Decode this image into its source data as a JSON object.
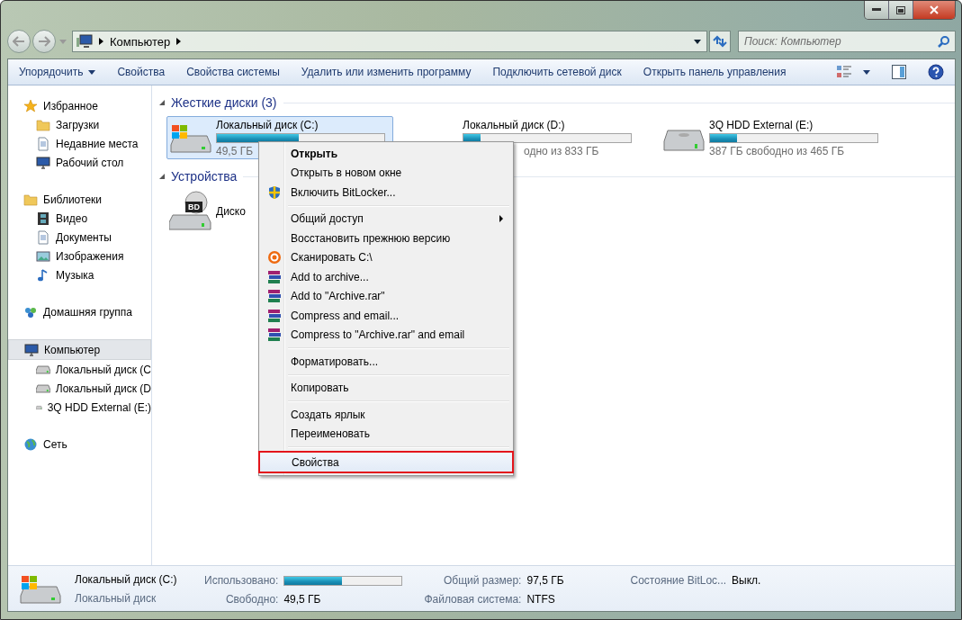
{
  "address_bar": {
    "path": [
      {
        "label": "Компьютер"
      }
    ]
  },
  "search": {
    "placeholder": "Поиск: Компьютер"
  },
  "toolbar": {
    "items": [
      {
        "label": "Упорядочить",
        "dropdown": true
      },
      {
        "label": "Свойства",
        "dropdown": false
      },
      {
        "label": "Свойства системы",
        "dropdown": false
      },
      {
        "label": "Удалить или изменить программу",
        "dropdown": false
      },
      {
        "label": "Подключить сетевой диск",
        "dropdown": false
      },
      {
        "label": "Открыть панель управления",
        "dropdown": false
      }
    ]
  },
  "sidebar": {
    "groups": [
      {
        "label": "Избранное",
        "selected": false,
        "children": [
          {
            "label": "Загрузки",
            "selected": false
          },
          {
            "label": "Недавние места",
            "selected": false
          },
          {
            "label": "Рабочий стол",
            "selected": false
          }
        ]
      },
      {
        "label": "Библиотеки",
        "selected": false,
        "children": [
          {
            "label": "Видео",
            "selected": false
          },
          {
            "label": "Документы",
            "selected": false
          },
          {
            "label": "Изображения",
            "selected": false
          },
          {
            "label": "Музыка",
            "selected": false
          }
        ]
      },
      {
        "label": "Домашняя группа",
        "selected": false
      },
      {
        "label": "Компьютер",
        "selected": true,
        "children": [
          {
            "label": "Локальный диск (C",
            "selected": false
          },
          {
            "label": "Локальный диск (D",
            "selected": false
          },
          {
            "label": "3Q HDD External (E:)",
            "selected": false
          }
        ]
      },
      {
        "label": "Сеть",
        "selected": false
      }
    ]
  },
  "content": {
    "sections": [
      {
        "title": "Жесткие диски (3)",
        "items": [
          {
            "name": "Локальный диск (C:)",
            "level": 0.49,
            "free": "49,5 ГБ",
            "selected": true
          },
          {
            "name": "Локальный диск (D:)",
            "level": 0.1,
            "free": "одно из 833 ГБ",
            "selected": false
          },
          {
            "name": "3Q HDD External (E:)",
            "level": 0.16,
            "free": "387 ГБ свободно из 465 ГБ",
            "selected": false
          }
        ]
      },
      {
        "title": "Устройства",
        "items": [
          {
            "name": "Диско",
            "badge": "BD",
            "selected": false
          }
        ]
      }
    ]
  },
  "context_menu": {
    "groups": [
      [
        {
          "label": "Открыть",
          "kind": "plain",
          "default": true,
          "submenu": false,
          "selected": false,
          "annotated": false
        },
        {
          "label": "Открыть в новом окне",
          "kind": "plain",
          "default": false,
          "submenu": false,
          "selected": false,
          "annotated": false
        },
        {
          "label": "Включить BitLocker...",
          "kind": "shield",
          "default": false,
          "submenu": false,
          "selected": false,
          "annotated": false
        }
      ],
      [
        {
          "label": "Общий доступ",
          "kind": "plain",
          "default": false,
          "submenu": true,
          "selected": false,
          "annotated": false
        },
        {
          "label": "Восстановить прежнюю версию",
          "kind": "plain",
          "default": false,
          "submenu": false,
          "selected": false,
          "annotated": false
        },
        {
          "label": "Сканировать C:\\",
          "kind": "scan",
          "default": false,
          "submenu": false,
          "selected": false,
          "annotated": false
        },
        {
          "label": "Add to archive...",
          "kind": "archive",
          "default": false,
          "submenu": false,
          "selected": false,
          "annotated": false
        },
        {
          "label": "Add to \"Archive.rar\"",
          "kind": "archive",
          "default": false,
          "submenu": false,
          "selected": false,
          "annotated": false
        },
        {
          "label": "Compress and email...",
          "kind": "archive",
          "default": false,
          "submenu": false,
          "selected": false,
          "annotated": false
        },
        {
          "label": "Compress to \"Archive.rar\" and email",
          "kind": "archive",
          "default": false,
          "submenu": false,
          "selected": false,
          "annotated": false
        }
      ],
      [
        {
          "label": "Форматировать...",
          "kind": "plain",
          "default": false,
          "submenu": false,
          "selected": false,
          "annotated": false
        }
      ],
      [
        {
          "label": "Копировать",
          "kind": "plain",
          "default": false,
          "submenu": false,
          "selected": false,
          "annotated": false
        }
      ],
      [
        {
          "label": "Создать ярлык",
          "kind": "plain",
          "default": false,
          "submenu": false,
          "selected": false,
          "annotated": false
        },
        {
          "label": "Переименовать",
          "kind": "plain",
          "default": false,
          "submenu": false,
          "selected": false,
          "annotated": false
        }
      ],
      [
        {
          "label": "Свойства",
          "kind": "plain",
          "default": false,
          "submenu": false,
          "selected": true,
          "annotated": true
        }
      ]
    ]
  },
  "details": {
    "name": "Локальный диск (C:)",
    "type": "Локальный диск",
    "fields": [
      {
        "label": "Использовано:",
        "kind": "bar",
        "level": 0.49
      },
      {
        "label": "Свободно:",
        "kind": "text",
        "value": "49,5 ГБ"
      },
      {
        "label": "Общий размер:",
        "kind": "text",
        "value": "97,5 ГБ"
      },
      {
        "label": "Файловая система:",
        "kind": "text",
        "value": "NTFS"
      },
      {
        "label": "Состояние BitLoc...",
        "kind": "text",
        "value": "Выкл."
      }
    ]
  }
}
